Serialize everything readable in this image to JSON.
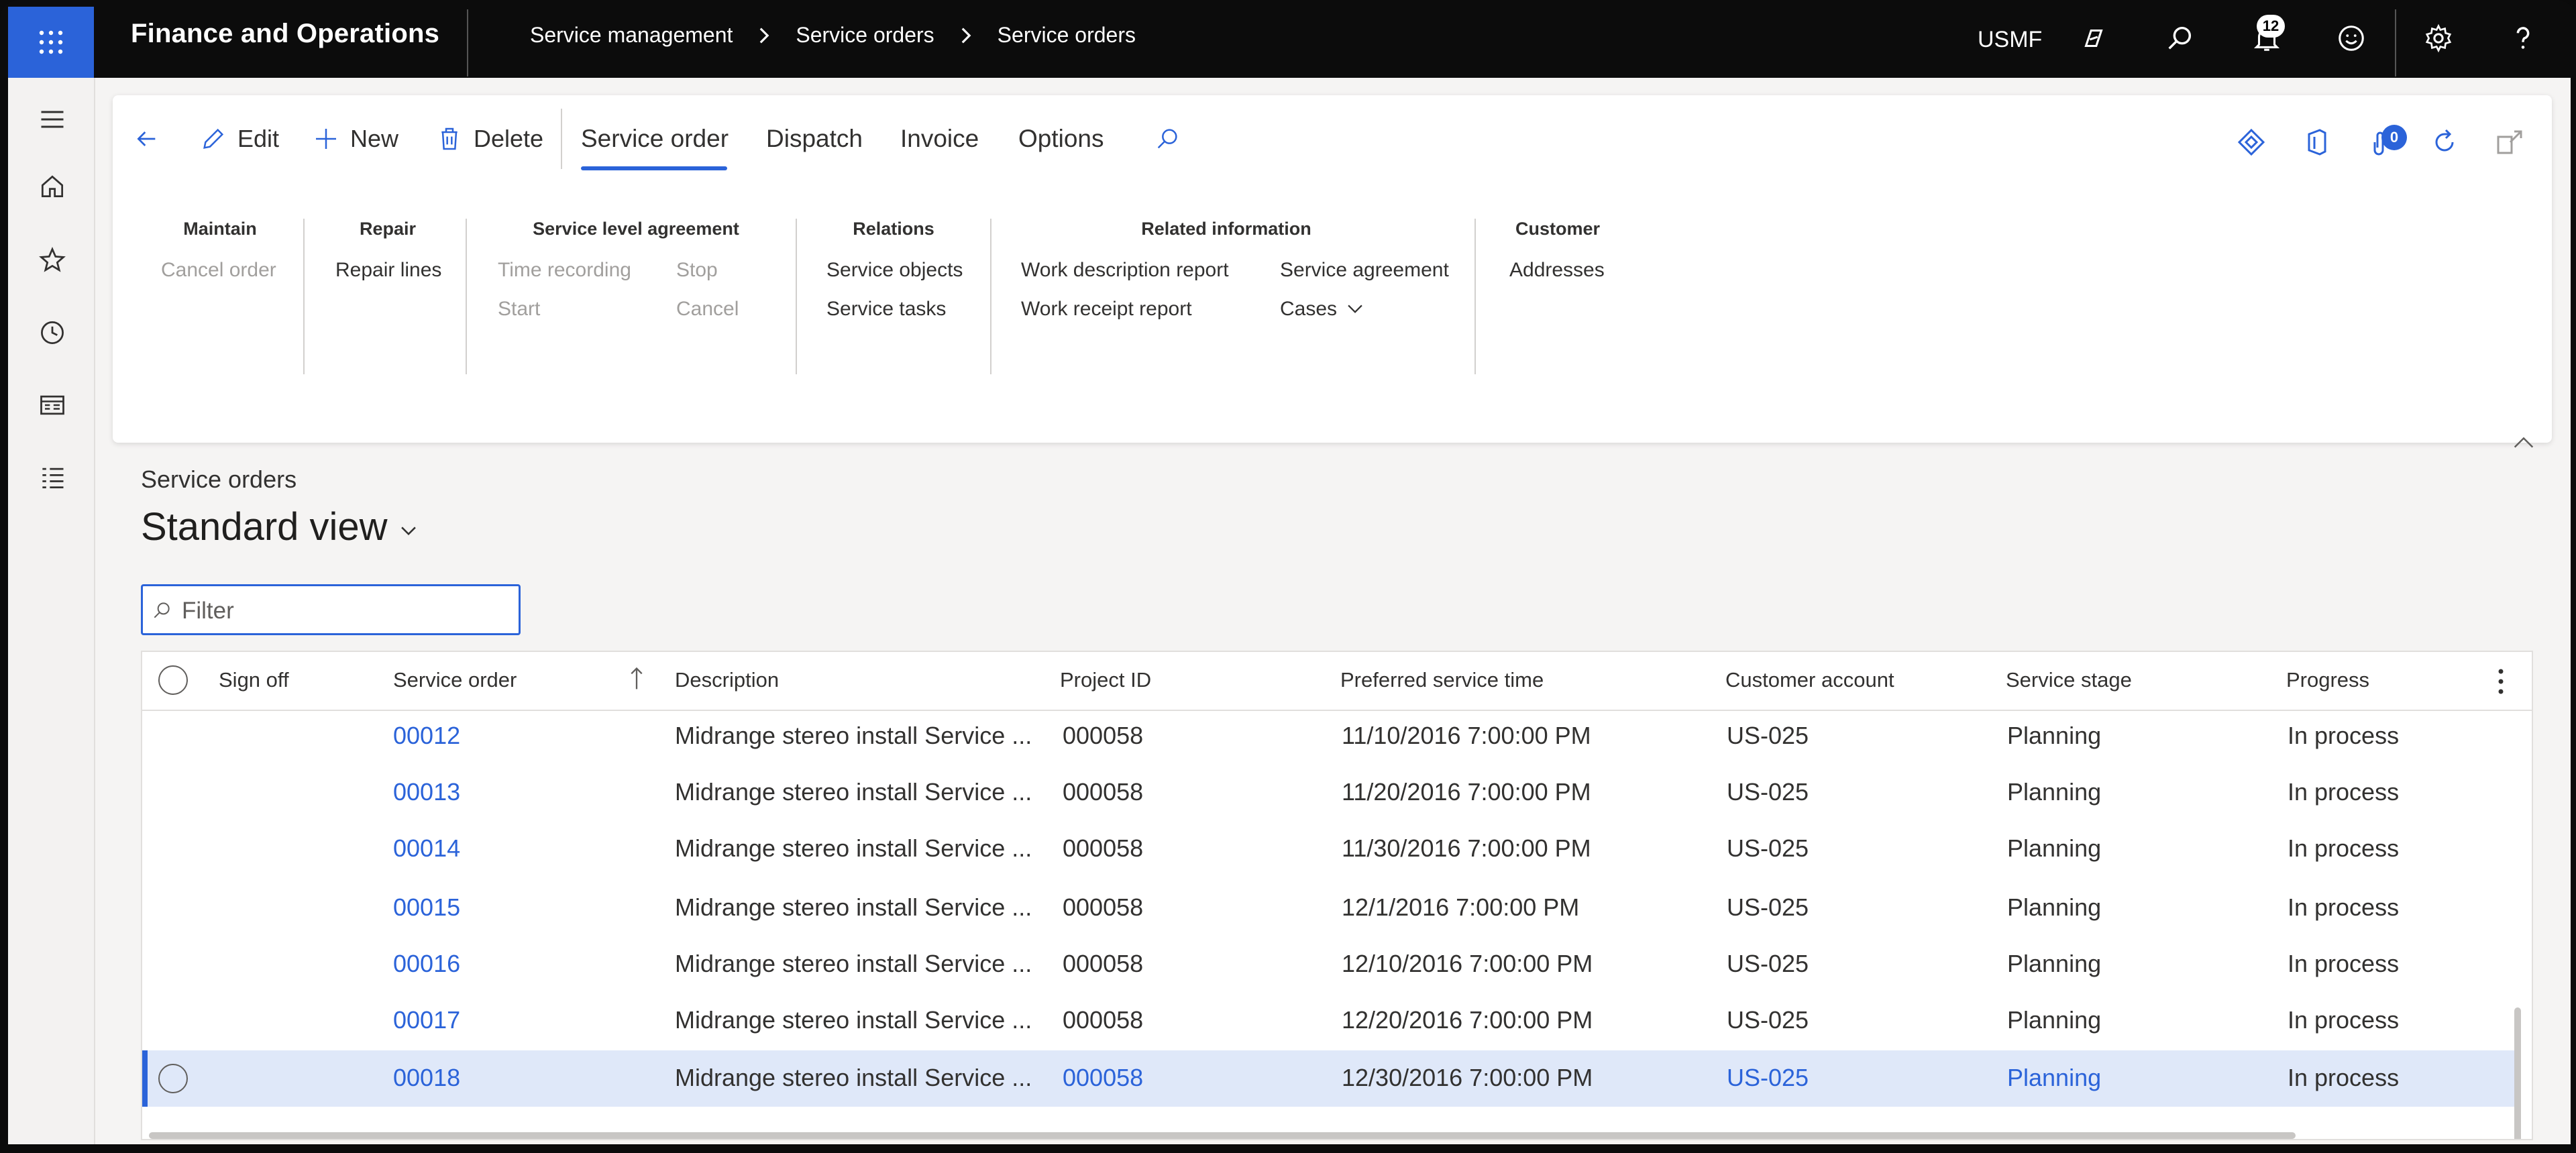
{
  "topbar": {
    "app_title": "Finance and Operations",
    "breadcrumbs": [
      "Service management",
      "Service orders",
      "Service orders"
    ],
    "company": "USMF",
    "notifications_count": "12"
  },
  "actions": {
    "edit": "Edit",
    "new": "New",
    "delete": "Delete",
    "tabs": [
      "Service order",
      "Dispatch",
      "Invoice",
      "Options"
    ],
    "attachments_count": "0"
  },
  "groups": {
    "maintain": {
      "title": "Maintain",
      "items": [
        "Cancel order"
      ]
    },
    "repair": {
      "title": "Repair",
      "items": [
        "Repair lines"
      ]
    },
    "sla": {
      "title": "Service level agreement",
      "items": [
        "Time recording",
        "Stop",
        "Start",
        "Cancel"
      ]
    },
    "relations": {
      "title": "Relations",
      "items": [
        "Service objects",
        "Service tasks"
      ]
    },
    "related": {
      "title": "Related information",
      "items": [
        "Work description report",
        "Service agreement",
        "Work receipt report",
        "Cases"
      ]
    },
    "customer": {
      "title": "Customer",
      "items": [
        "Addresses"
      ]
    }
  },
  "page": {
    "caption": "Service orders",
    "view": "Standard view",
    "filter_placeholder": "Filter"
  },
  "grid": {
    "headers": [
      "Sign off",
      "Service order",
      "Description",
      "Project ID",
      "Preferred service time",
      "Customer account",
      "Service stage",
      "Progress"
    ],
    "rows": [
      {
        "order": "00012",
        "desc": "Midrange stereo install Service ...",
        "project": "000058",
        "time": "11/10/2016 7:00:00 PM",
        "account": "US-025",
        "stage": "Planning",
        "progress": "In process"
      },
      {
        "order": "00013",
        "desc": "Midrange stereo install Service ...",
        "project": "000058",
        "time": "11/20/2016 7:00:00 PM",
        "account": "US-025",
        "stage": "Planning",
        "progress": "In process"
      },
      {
        "order": "00014",
        "desc": "Midrange stereo install Service ...",
        "project": "000058",
        "time": "11/30/2016 7:00:00 PM",
        "account": "US-025",
        "stage": "Planning",
        "progress": "In process"
      },
      {
        "order": "00015",
        "desc": "Midrange stereo install Service ...",
        "project": "000058",
        "time": "12/1/2016 7:00:00 PM",
        "account": "US-025",
        "stage": "Planning",
        "progress": "In process"
      },
      {
        "order": "00016",
        "desc": "Midrange stereo install Service ...",
        "project": "000058",
        "time": "12/10/2016 7:00:00 PM",
        "account": "US-025",
        "stage": "Planning",
        "progress": "In process"
      },
      {
        "order": "00017",
        "desc": "Midrange stereo install Service ...",
        "project": "000058",
        "time": "12/20/2016 7:00:00 PM",
        "account": "US-025",
        "stage": "Planning",
        "progress": "In process"
      },
      {
        "order": "00018",
        "desc": "Midrange stereo install Service ...",
        "project": "000058",
        "time": "12/30/2016 7:00:00 PM",
        "account": "US-025",
        "stage": "Planning",
        "progress": "In process"
      }
    ]
  },
  "colors": {
    "accent": "#2b63d9",
    "topbar": "#0c0c0c",
    "selected_row": "#dfe8f9"
  }
}
